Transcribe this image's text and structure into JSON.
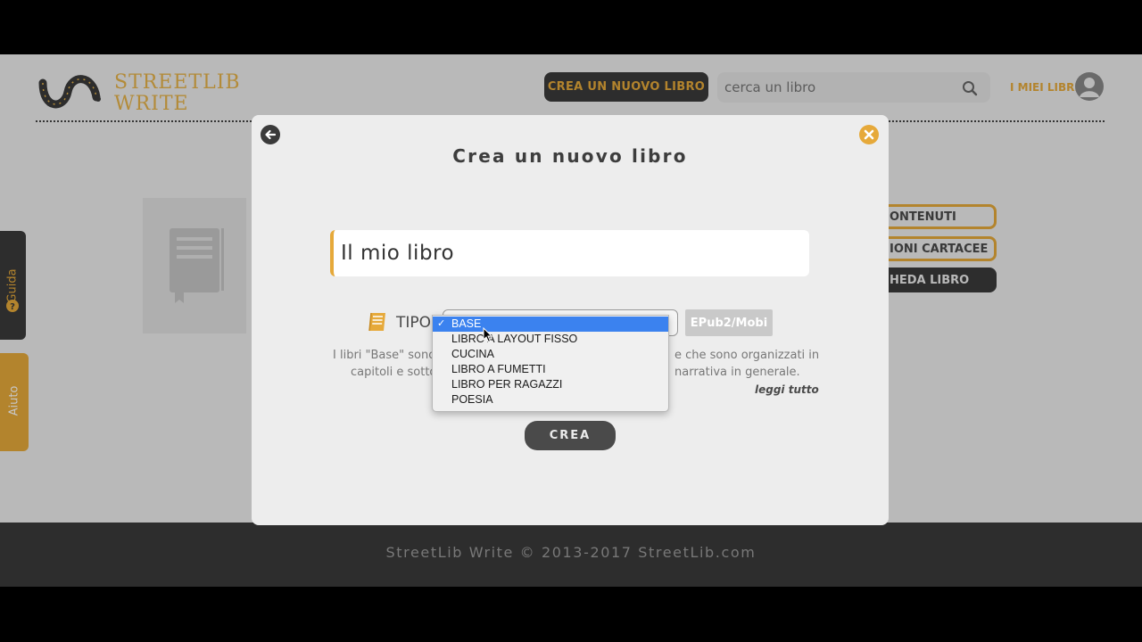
{
  "header": {
    "logo_line1": "STREETLIB",
    "logo_line2": "WRITE",
    "cta_label": "CREA UN NUOVO LIBRO",
    "search_placeholder": "cerca un libro",
    "my_books_label": "I MIEI LIBRI"
  },
  "background": {
    "side_buttons": [
      "ONTENUTI",
      "IONI CARTACEE",
      "HEDA LIBRO"
    ],
    "guida_label": "Guida",
    "aiuto_label": "Aiuto",
    "footer_text": "StreetLib Write © 2013-2017 StreetLib.com"
  },
  "modal": {
    "title": "Crea un nuovo libro",
    "book_title_value": "Il mio libro",
    "tipo_label": "TIPO",
    "format_badge": "EPub2/Mobi",
    "description_left_1": "I libri \"Base\" sono",
    "description_right_1": "e che sono organizzati in",
    "description_left_2": "capitoli e sotto",
    "description_right_2": "narrativa in generale.",
    "read_more": "leggi tutto",
    "create_label": "CREA"
  },
  "dropdown": {
    "check_mark": "✓",
    "options": [
      "BASE",
      "LIBRO A LAYOUT FISSO",
      "CUCINA",
      "LIBRO A FUMETTI",
      "LIBRO PER RAGAZZI",
      "POESIA"
    ],
    "selected": "BASE"
  },
  "colors": {
    "accent": "#e6a93a",
    "dark": "#3a3a3a",
    "selection": "#3b82ef"
  }
}
